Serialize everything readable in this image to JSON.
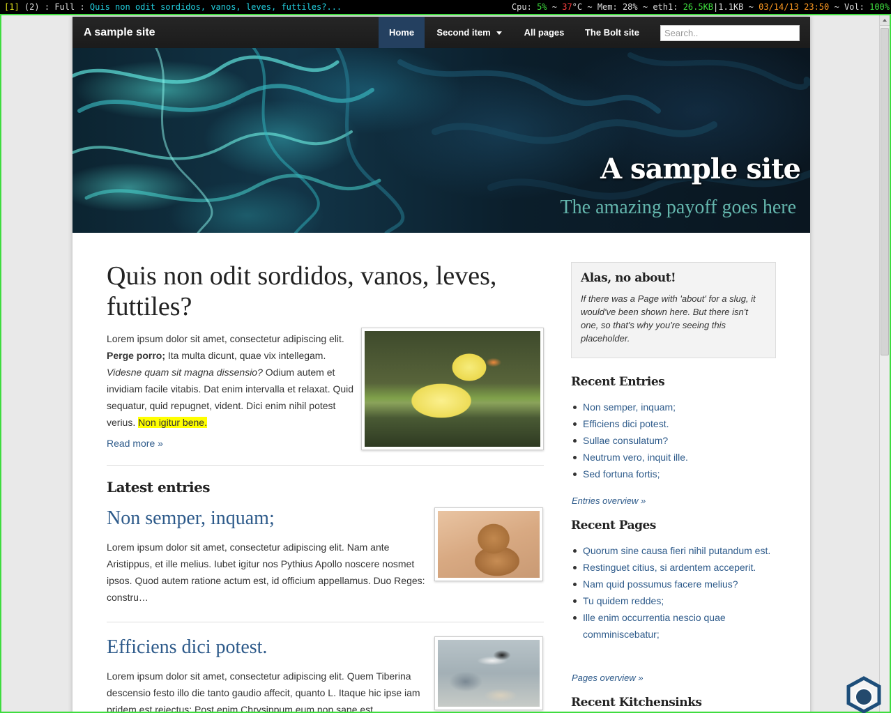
{
  "wm": {
    "tag_active": "[1]",
    "tag_other": "(2)",
    "sep": ":",
    "layout": "Full",
    "window_title": "Quis non odit sordidos, vanos, leves, futtiles?...",
    "cpu_label": "Cpu:",
    "cpu_value": "5%",
    "temp_value": "37",
    "temp_unit": "°C ~",
    "mem_label": "Mem:",
    "mem_value": "28%",
    "net_label": "~ eth1:",
    "net_down": "26.5KB",
    "net_sep": "|",
    "net_up": "1.1KB",
    "datetime": "03/14/13 23:50",
    "vol_label": "~ Vol:",
    "vol_value": "100%",
    "tilde": "~"
  },
  "navbar": {
    "brand": "A sample site",
    "items": [
      {
        "label": "Home"
      },
      {
        "label": "Second item"
      },
      {
        "label": "All pages"
      },
      {
        "label": "The Bolt site"
      }
    ],
    "search_placeholder": "Search.."
  },
  "header": {
    "title": "A sample site",
    "subtitle": "The amazing payoff goes here"
  },
  "post": {
    "title": "Quis non odit sordidos, vanos, leves, futtiles?",
    "text_1": "Lorem ipsum dolor sit amet, consectetur adipiscing elit.",
    "text_bold": "Perge porro;",
    "text_2": " Ita multa dicunt, quae vix intellegam.",
    "text_italic": "Videsne quam sit magna dissensio?",
    "text_3": " Odium autem et invidiam facile vitabis. Dat enim intervalla et relaxat. Quid sequatur, quid repugnet, vident. Dici enim nihil potest verius. ",
    "text_highlight": "Non igitur bene.",
    "read_more": "Read more »"
  },
  "latest": {
    "heading": "Latest entries",
    "entries": [
      {
        "title": "Non semper, inquam;",
        "text": "Lorem ipsum dolor sit amet, consectetur adipiscing elit. Nam ante Aristippus, et ille melius. Iubet igitur nos Pythius Apollo noscere nosmet ipsos. Quod autem ratione actum est, id officium appellamus. Duo Reges: constru…"
      },
      {
        "title": "Efficiens dici potest.",
        "text": "Lorem ipsum dolor sit amet, consectetur adipiscing elit. Quem Tiberina descensio festo illo die tanto gaudio affecit, quanto L. Itaque hic ipse iam pridem est reiectus; Post enim Chrysippum eum non sane est"
      }
    ]
  },
  "sidebar": {
    "about_title": "Alas, no about!",
    "about_text": "If there was a Page with 'about' for a slug, it would've been shown here. But there isn't one, so that's why you're seeing this placeholder.",
    "recent_entries_heading": "Recent Entries",
    "recent_entries": [
      "Non semper, inquam;",
      "Efficiens dici potest.",
      "Sullae consulatum?",
      "Neutrum vero, inquit ille.",
      "Sed fortuna fortis;"
    ],
    "entries_overview": "Entries overview »",
    "recent_pages_heading": "Recent Pages",
    "recent_pages": [
      "Quorum sine causa fieri nihil putandum est.",
      "Restinguet citius, si ardentem acceperit.",
      "Nam quid possumus facere melius?",
      "Tu quidem reddes;",
      "Ille enim occurrentia nescio quae comminiscebatur;"
    ],
    "pages_overview": "Pages overview »",
    "recent_kitchensinks_heading": "Recent Kitchensinks"
  },
  "colors": {
    "link": "#2d5a8a",
    "nav_active": "#244060",
    "highlight": "#ffff00",
    "frame_border": "#3fdc3f"
  },
  "icons": {
    "corner_widget": "hexagon-logo-icon"
  }
}
